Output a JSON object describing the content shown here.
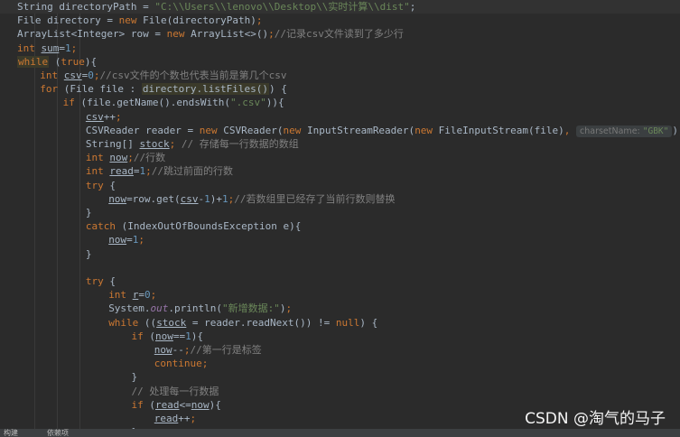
{
  "editor": {
    "lines": [
      {
        "indent": 0,
        "current": true,
        "tokens": [
          {
            "t": "String directoryPath = "
          },
          {
            "t": "\"C:\\\\Users\\\\lenovo\\\\Desktop\\\\实时计算\\\\dist\"",
            "c": "str"
          },
          {
            "t": ";"
          }
        ]
      },
      {
        "indent": 0,
        "tokens": [
          {
            "t": "File directory = "
          },
          {
            "t": "new",
            "c": "kw"
          },
          {
            "t": " File(directoryPath)"
          },
          {
            "t": ";",
            "c": "kw"
          }
        ]
      },
      {
        "indent": 0,
        "tokens": [
          {
            "t": "ArrayList<Integer> row = "
          },
          {
            "t": "new",
            "c": "kw"
          },
          {
            "t": " ArrayList<>()"
          },
          {
            "t": ";",
            "c": "kw"
          },
          {
            "t": "//记录csv文件读到了多少行",
            "c": "cmt"
          }
        ]
      },
      {
        "indent": 0,
        "tokens": [
          {
            "t": "int",
            "c": "kw"
          },
          {
            "t": " "
          },
          {
            "t": "sum",
            "c": "ul"
          },
          {
            "t": "="
          },
          {
            "t": "1",
            "c": "num"
          },
          {
            "t": ";",
            "c": "kw"
          }
        ]
      },
      {
        "indent": 0,
        "tokens": [
          {
            "t": "while",
            "c": "kw hl"
          },
          {
            "t": " ("
          },
          {
            "t": "true",
            "c": "kw"
          },
          {
            "t": "){"
          }
        ]
      },
      {
        "indent": 1,
        "tokens": [
          {
            "t": "int",
            "c": "kw"
          },
          {
            "t": " "
          },
          {
            "t": "csv",
            "c": "ul"
          },
          {
            "t": "="
          },
          {
            "t": "0",
            "c": "num"
          },
          {
            "t": ";",
            "c": "kw"
          },
          {
            "t": "//csv文件的个数也代表当前是第几个csv",
            "c": "cmt"
          }
        ]
      },
      {
        "indent": 1,
        "tokens": [
          {
            "t": "for",
            "c": "kw"
          },
          {
            "t": " (File file : "
          },
          {
            "t": "directory.listFiles()",
            "c": "hl"
          },
          {
            "t": ") {"
          }
        ]
      },
      {
        "indent": 2,
        "tokens": [
          {
            "t": "if",
            "c": "kw"
          },
          {
            "t": " (file.getName().endsWith("
          },
          {
            "t": "\".csv\"",
            "c": "str"
          },
          {
            "t": ")){"
          }
        ]
      },
      {
        "indent": 3,
        "tokens": [
          {
            "t": "csv",
            "c": "ul"
          },
          {
            "t": "++"
          },
          {
            "t": ";",
            "c": "kw"
          }
        ]
      },
      {
        "indent": 3,
        "tokens": [
          {
            "t": "CSVReader reader = "
          },
          {
            "t": "new",
            "c": "kw"
          },
          {
            "t": " CSVReader("
          },
          {
            "t": "new",
            "c": "kw"
          },
          {
            "t": " InputStreamReader("
          },
          {
            "t": "new",
            "c": "kw"
          },
          {
            "t": " FileInputStream(file)"
          },
          {
            "t": ", ",
            "c": "kw"
          },
          {
            "hint": "charsetName:",
            "hv": "\"GBK\""
          },
          {
            "t": "))"
          },
          {
            "t": ";",
            "c": "kw"
          }
        ]
      },
      {
        "indent": 3,
        "tokens": [
          {
            "t": "String[] "
          },
          {
            "t": "stock",
            "c": "ul"
          },
          {
            "t": "; ",
            "c": "kw"
          },
          {
            "t": "// 存储每一行数据的数组",
            "c": "cmt"
          }
        ]
      },
      {
        "indent": 3,
        "tokens": [
          {
            "t": "int",
            "c": "kw"
          },
          {
            "t": " "
          },
          {
            "t": "now",
            "c": "ul"
          },
          {
            "t": ";",
            "c": "kw"
          },
          {
            "t": "//行数",
            "c": "cmt"
          }
        ]
      },
      {
        "indent": 3,
        "tokens": [
          {
            "t": "int",
            "c": "kw"
          },
          {
            "t": " "
          },
          {
            "t": "read",
            "c": "ul"
          },
          {
            "t": "="
          },
          {
            "t": "1",
            "c": "num"
          },
          {
            "t": ";",
            "c": "kw"
          },
          {
            "t": "//跳过前面的行数",
            "c": "cmt"
          }
        ]
      },
      {
        "indent": 3,
        "tokens": [
          {
            "t": "try",
            "c": "kw"
          },
          {
            "t": " {"
          }
        ]
      },
      {
        "indent": 4,
        "tokens": [
          {
            "t": "now",
            "c": "ul"
          },
          {
            "t": "=row.get("
          },
          {
            "t": "csv",
            "c": "ul"
          },
          {
            "t": "-"
          },
          {
            "t": "1",
            "c": "num"
          },
          {
            "t": ")+"
          },
          {
            "t": "1",
            "c": "num"
          },
          {
            "t": ";",
            "c": "kw"
          },
          {
            "t": "//若数组里已经存了当前行数则替换",
            "c": "cmt"
          }
        ]
      },
      {
        "indent": 3,
        "tokens": [
          {
            "t": "}"
          }
        ]
      },
      {
        "indent": 3,
        "tokens": [
          {
            "t": "catch",
            "c": "kw"
          },
          {
            "t": " (IndexOutOfBoundsException e){"
          }
        ]
      },
      {
        "indent": 4,
        "tokens": [
          {
            "t": "now",
            "c": "ul"
          },
          {
            "t": "="
          },
          {
            "t": "1",
            "c": "num"
          },
          {
            "t": ";",
            "c": "kw"
          }
        ]
      },
      {
        "indent": 3,
        "tokens": [
          {
            "t": "}"
          }
        ]
      },
      {
        "indent": 0,
        "tokens": []
      },
      {
        "indent": 3,
        "tokens": [
          {
            "t": "try",
            "c": "kw"
          },
          {
            "t": " {"
          }
        ]
      },
      {
        "indent": 4,
        "tokens": [
          {
            "t": "int",
            "c": "kw"
          },
          {
            "t": " "
          },
          {
            "t": "r",
            "c": "ul"
          },
          {
            "t": "="
          },
          {
            "t": "0",
            "c": "num"
          },
          {
            "t": ";",
            "c": "kw"
          }
        ]
      },
      {
        "indent": 4,
        "tokens": [
          {
            "t": "System."
          },
          {
            "t": "out",
            "c": "fld"
          },
          {
            "t": ".println("
          },
          {
            "t": "\"新增数据:\"",
            "c": "str"
          },
          {
            "t": ")"
          },
          {
            "t": ";",
            "c": "kw"
          }
        ]
      },
      {
        "indent": 4,
        "tokens": [
          {
            "t": "while",
            "c": "kw"
          },
          {
            "t": " (("
          },
          {
            "t": "stock",
            "c": "ul"
          },
          {
            "t": " = reader.readNext()) != "
          },
          {
            "t": "null",
            "c": "kw"
          },
          {
            "t": ") {"
          }
        ]
      },
      {
        "indent": 5,
        "tokens": [
          {
            "t": "if",
            "c": "kw"
          },
          {
            "t": " ("
          },
          {
            "t": "now",
            "c": "ul"
          },
          {
            "t": "=="
          },
          {
            "t": "1",
            "c": "num"
          },
          {
            "t": "){"
          }
        ]
      },
      {
        "indent": 6,
        "tokens": [
          {
            "t": "now",
            "c": "ul"
          },
          {
            "t": "--"
          },
          {
            "t": ";",
            "c": "kw"
          },
          {
            "t": "//第一行是标签",
            "c": "cmt"
          }
        ]
      },
      {
        "indent": 6,
        "tokens": [
          {
            "t": "continue",
            "c": "kw"
          },
          {
            "t": ";",
            "c": "kw"
          }
        ]
      },
      {
        "indent": 5,
        "tokens": [
          {
            "t": "}"
          }
        ]
      },
      {
        "indent": 5,
        "tokens": [
          {
            "t": "// 处理每一行数据",
            "c": "cmt"
          }
        ]
      },
      {
        "indent": 5,
        "tokens": [
          {
            "t": "if",
            "c": "kw"
          },
          {
            "t": " ("
          },
          {
            "t": "read",
            "c": "ul"
          },
          {
            "t": "<="
          },
          {
            "t": "now",
            "c": "ul"
          },
          {
            "t": "){"
          }
        ]
      },
      {
        "indent": 6,
        "tokens": [
          {
            "t": "read",
            "c": "ul"
          },
          {
            "t": "++"
          },
          {
            "t": ";",
            "c": "kw"
          }
        ]
      },
      {
        "indent": 5,
        "tokens": [
          {
            "t": "}"
          }
        ]
      }
    ]
  },
  "bottombar": {
    "tab1": "构建",
    "tab2": "依赖项"
  },
  "watermark": "CSDN @淘气的马子"
}
